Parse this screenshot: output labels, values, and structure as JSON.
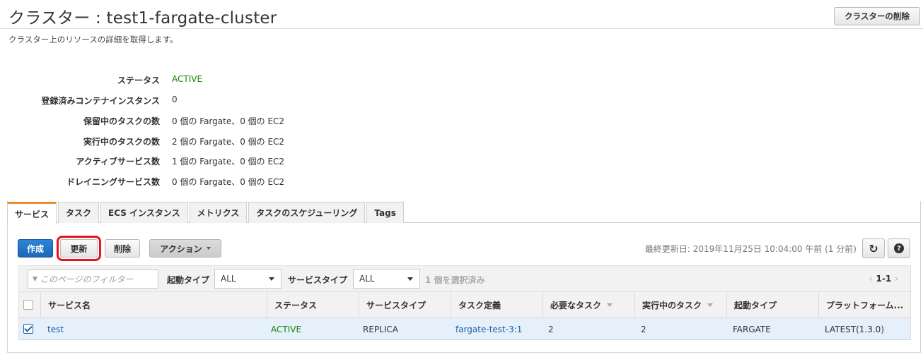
{
  "page": {
    "title": "クラスター : test1-fargate-cluster",
    "description": "クラスター上のリソースの詳細を取得します。",
    "delete_cluster_label": "クラスターの削除"
  },
  "details": [
    {
      "label": "ステータス",
      "value": "ACTIVE"
    },
    {
      "label": "登録済みコンテナインスタンス",
      "value": "0"
    },
    {
      "label": "保留中のタスクの数",
      "value": "0 個の Fargate、0 個の EC2"
    },
    {
      "label": "実行中のタスクの数",
      "value": "2 個の Fargate、0 個の EC2"
    },
    {
      "label": "アクティブサービス数",
      "value": "1 個の Fargate、0 個の EC2"
    },
    {
      "label": "ドレイニングサービス数",
      "value": "0 個の Fargate、0 個の EC2"
    }
  ],
  "tabs": [
    "サービス",
    "タスク",
    "ECS インスタンス",
    "メトリクス",
    "タスクのスケジューリング",
    "Tags"
  ],
  "toolbar": {
    "create_label": "作成",
    "update_label": "更新",
    "delete_label": "削除",
    "actions_label": "アクション",
    "last_updated": "最終更新日: 2019年11月25日 10:04:00 午前 (1 分前)",
    "refresh_icon": "↻",
    "help_icon": "?"
  },
  "filter": {
    "placeholder": "このページのフィルター",
    "filter_icon": "▼",
    "launch_type_label": "起動タイプ",
    "launch_type_value": "ALL",
    "service_type_label": "サービスタイプ",
    "service_type_value": "ALL",
    "selected_count": "1 個を選択済み",
    "pager_range": "1-1",
    "prev_icon": "‹",
    "next_icon": "›"
  },
  "table": {
    "headers": [
      "サービス名",
      "ステータス",
      "サービスタイプ",
      "タスク定義",
      "必要なタスク",
      "実行中のタスク",
      "起動タイプ",
      "プラットフォーム..."
    ],
    "rows": [
      {
        "name": "test",
        "status": "ACTIVE",
        "service_type": "REPLICA",
        "task_def": "fargate-test-3:1",
        "desired": "2",
        "running": "2",
        "launch_type": "FARGATE",
        "platform": "LATEST(1.3.0)"
      }
    ]
  },
  "colors": {
    "active": "#1d8102",
    "link": "#1f5fa6",
    "primary": "#1c67b8",
    "tab_accent": "#e88f2c",
    "highlight": "#e8121c"
  }
}
